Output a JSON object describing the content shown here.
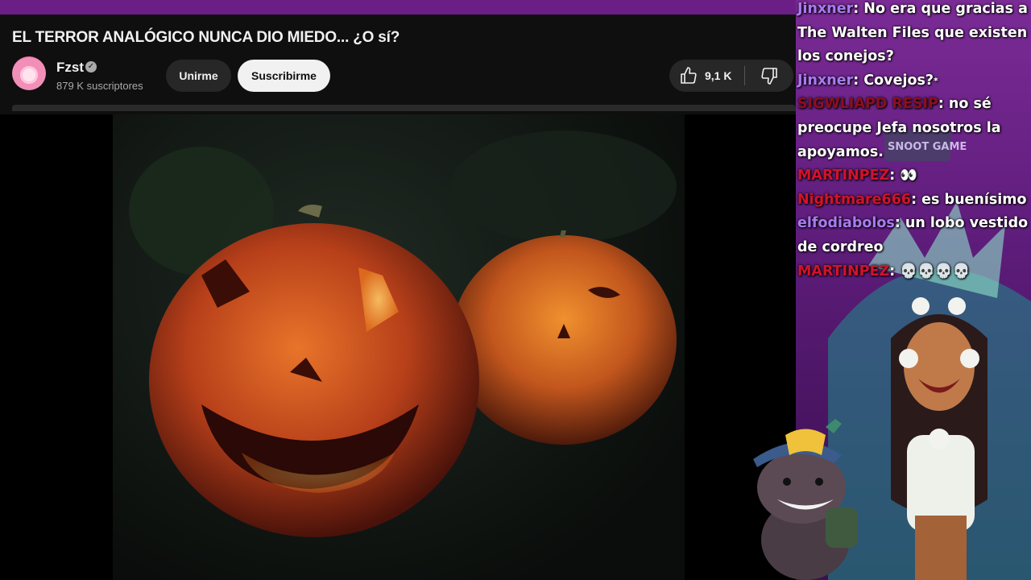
{
  "video": {
    "title": "EL TERROR ANALÓGICO NUNCA DIO MIEDO... ¿O sí?",
    "channel_name": "Fzst",
    "subscribers": "879 K suscriptores",
    "join_label": "Unirme",
    "subscribe_label": "Suscribirme",
    "like_count": "9,1 K",
    "verified_icon": "verified-check-icon",
    "like_icon": "thumbs-up-icon",
    "dislike_icon": "thumbs-down-icon"
  },
  "chat": {
    "messages": [
      {
        "user": "",
        "text": "Jinxner",
        "after": ": No era que gracias a The Walten Files que existen los conejos?",
        "user_color": "purple"
      },
      {
        "user": "Jinxner",
        "text": ": Covejos?",
        "suffix": "*",
        "user_color": "purple"
      },
      {
        "user": "SIGWLIAPD RESIP",
        "text": ": no sé preocupe Jefa nosotros la apoyamos.",
        "user_color": "dark"
      },
      {
        "user": "MARTINPEZ",
        "text": ": 👀",
        "user_color": "red"
      },
      {
        "user": "Nightmare666",
        "text": ": es buenísimo",
        "user_color": "red"
      },
      {
        "user": "elfodiabolos",
        "text": ": un lobo vestido de cordreo",
        "user_color": "purple"
      },
      {
        "user": "MARTINPEZ",
        "text": ": 💀💀💀💀",
        "user_color": "red"
      }
    ],
    "snoot_sign": "SNOOT GAME"
  },
  "colors": {
    "background": "#0f0f0f",
    "stream_purple": "#7b2b96",
    "subscribe_bg": "#f1f1f1",
    "button_dark": "#272727"
  }
}
